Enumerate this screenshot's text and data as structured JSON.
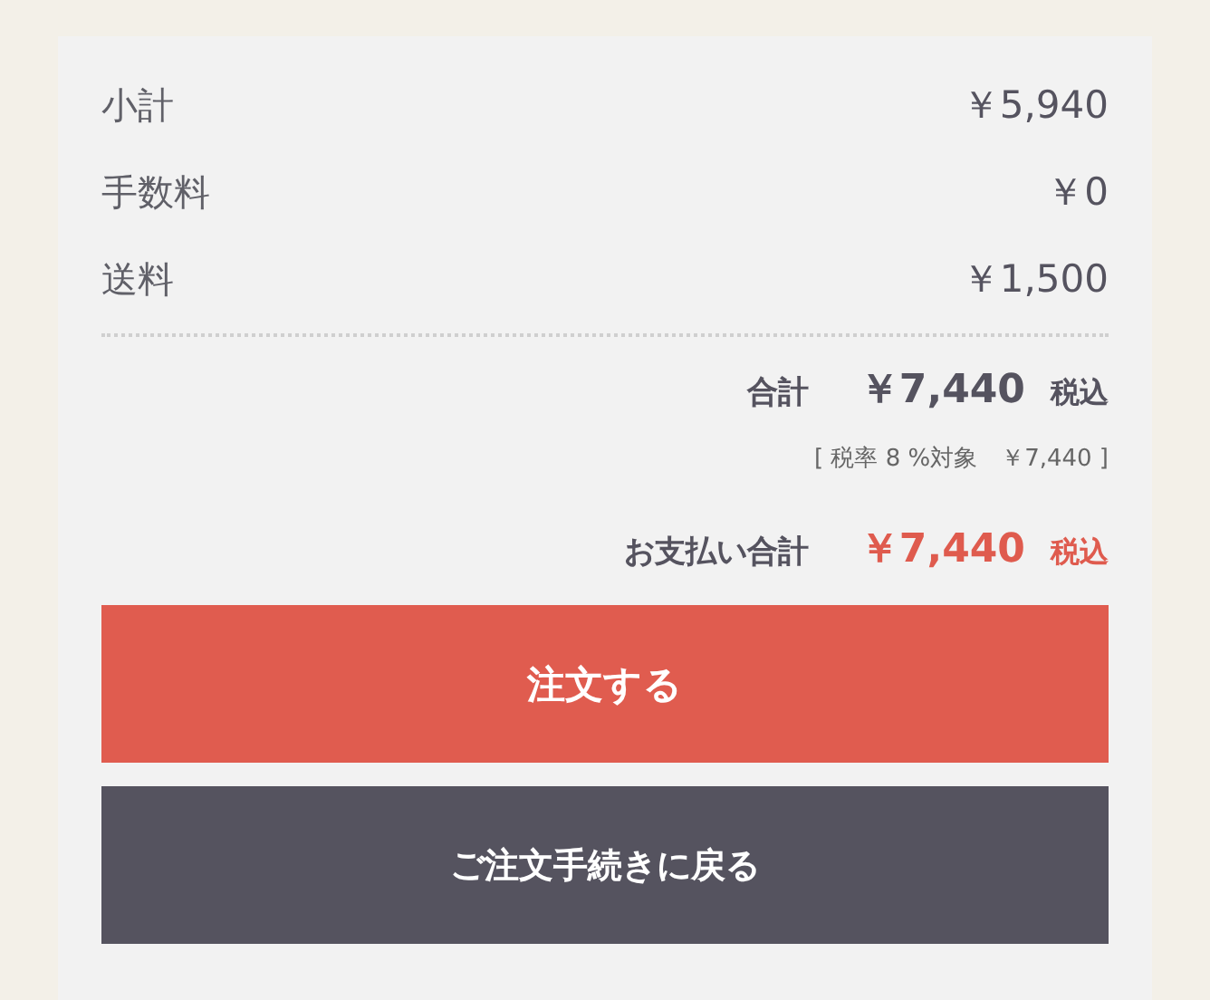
{
  "lines": [
    {
      "label": "小計",
      "amount": "￥5,940"
    },
    {
      "label": "手数料",
      "amount": "￥0"
    },
    {
      "label": "送料",
      "amount": "￥1,500"
    }
  ],
  "total": {
    "label": "合計",
    "amount": "￥7,440",
    "tax": "税込"
  },
  "tax_note": "[ 税率 8 %対象　￥7,440 ]",
  "payment_total": {
    "label": "お支払い合計",
    "amount": "￥7,440",
    "tax": "税込"
  },
  "buttons": [
    {
      "label": "注文する",
      "kind": "primary"
    },
    {
      "label": "ご注文手続きに戻る",
      "kind": "secondary"
    }
  ]
}
